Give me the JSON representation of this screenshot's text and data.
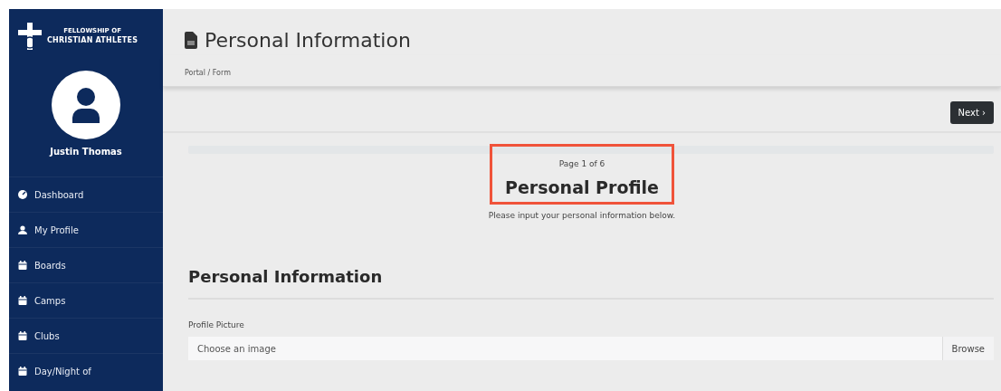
{
  "sidebar": {
    "logo": {
      "line_1": "FELLOWSHIP OF",
      "line_2": "CHRISTIAN ATHLETES"
    },
    "user_name": "Justin Thomas",
    "items": [
      {
        "label": "Dashboard",
        "kind": "gauge",
        "selected": false
      },
      {
        "label": "My Profile",
        "kind": "person",
        "selected": false
      },
      {
        "label": "Boards",
        "kind": "calendar",
        "selected": false
      },
      {
        "label": "Camps",
        "kind": "calendar",
        "selected": false
      },
      {
        "label": "Clubs",
        "kind": "calendar",
        "selected": false
      },
      {
        "label": "Day/Night of",
        "kind": "calendar",
        "selected": false
      }
    ]
  },
  "header": {
    "title": "Personal Information",
    "breadcrumb": "Portal / Form"
  },
  "toolbar": {
    "next_button": "Next ›"
  },
  "form": {
    "page_indicator": "Page 1 of 6",
    "page_title": "Personal Profile",
    "highlighted": true,
    "intro": "Please input your personal information below.",
    "section_title": "Personal Information",
    "fields": [
      {
        "label": "Profile Picture",
        "placeholder": "Choose an image",
        "button": "Browse"
      }
    ]
  }
}
